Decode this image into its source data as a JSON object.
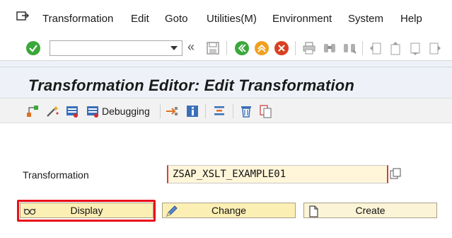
{
  "menu": {
    "items": [
      "Transformation",
      "Edit",
      "Goto",
      "Utilities(M)",
      "Environment",
      "System",
      "Help"
    ],
    "menu_icon": "menu-exit-icon"
  },
  "toolbar": {
    "command_field_value": "",
    "icons": [
      "enter-checkmark-icon",
      "save-icon",
      "back-icon",
      "exit-icon",
      "cancel-icon",
      "print-icon",
      "find-icon",
      "find-next-icon",
      "first-page-icon",
      "previous-page-icon",
      "next-page-icon",
      "last-page-icon"
    ]
  },
  "page": {
    "title": "Transformation Editor: Edit Transformation"
  },
  "app_toolbar": {
    "debugging_label": "Debugging",
    "icons": [
      "hierarchy-icon",
      "magic-wand-icon",
      "breakpoint-icon",
      "debugging-icon",
      "navigate-icon",
      "info-icon",
      "align-icon",
      "delete-icon",
      "copy-icon"
    ]
  },
  "form": {
    "transformation_label": "Transformation",
    "transformation_value": "ZSAP_XSLT_EXAMPLE01"
  },
  "buttons": {
    "display": "Display",
    "change": "Change",
    "create": "Create"
  },
  "colors": {
    "accent_red": "#e8101a",
    "button_yellow": "#fcefb4",
    "input_yellow": "#fff6d9",
    "green_check": "#3aa83a",
    "orange_exit": "#f0a020",
    "red_cancel": "#d84020"
  }
}
